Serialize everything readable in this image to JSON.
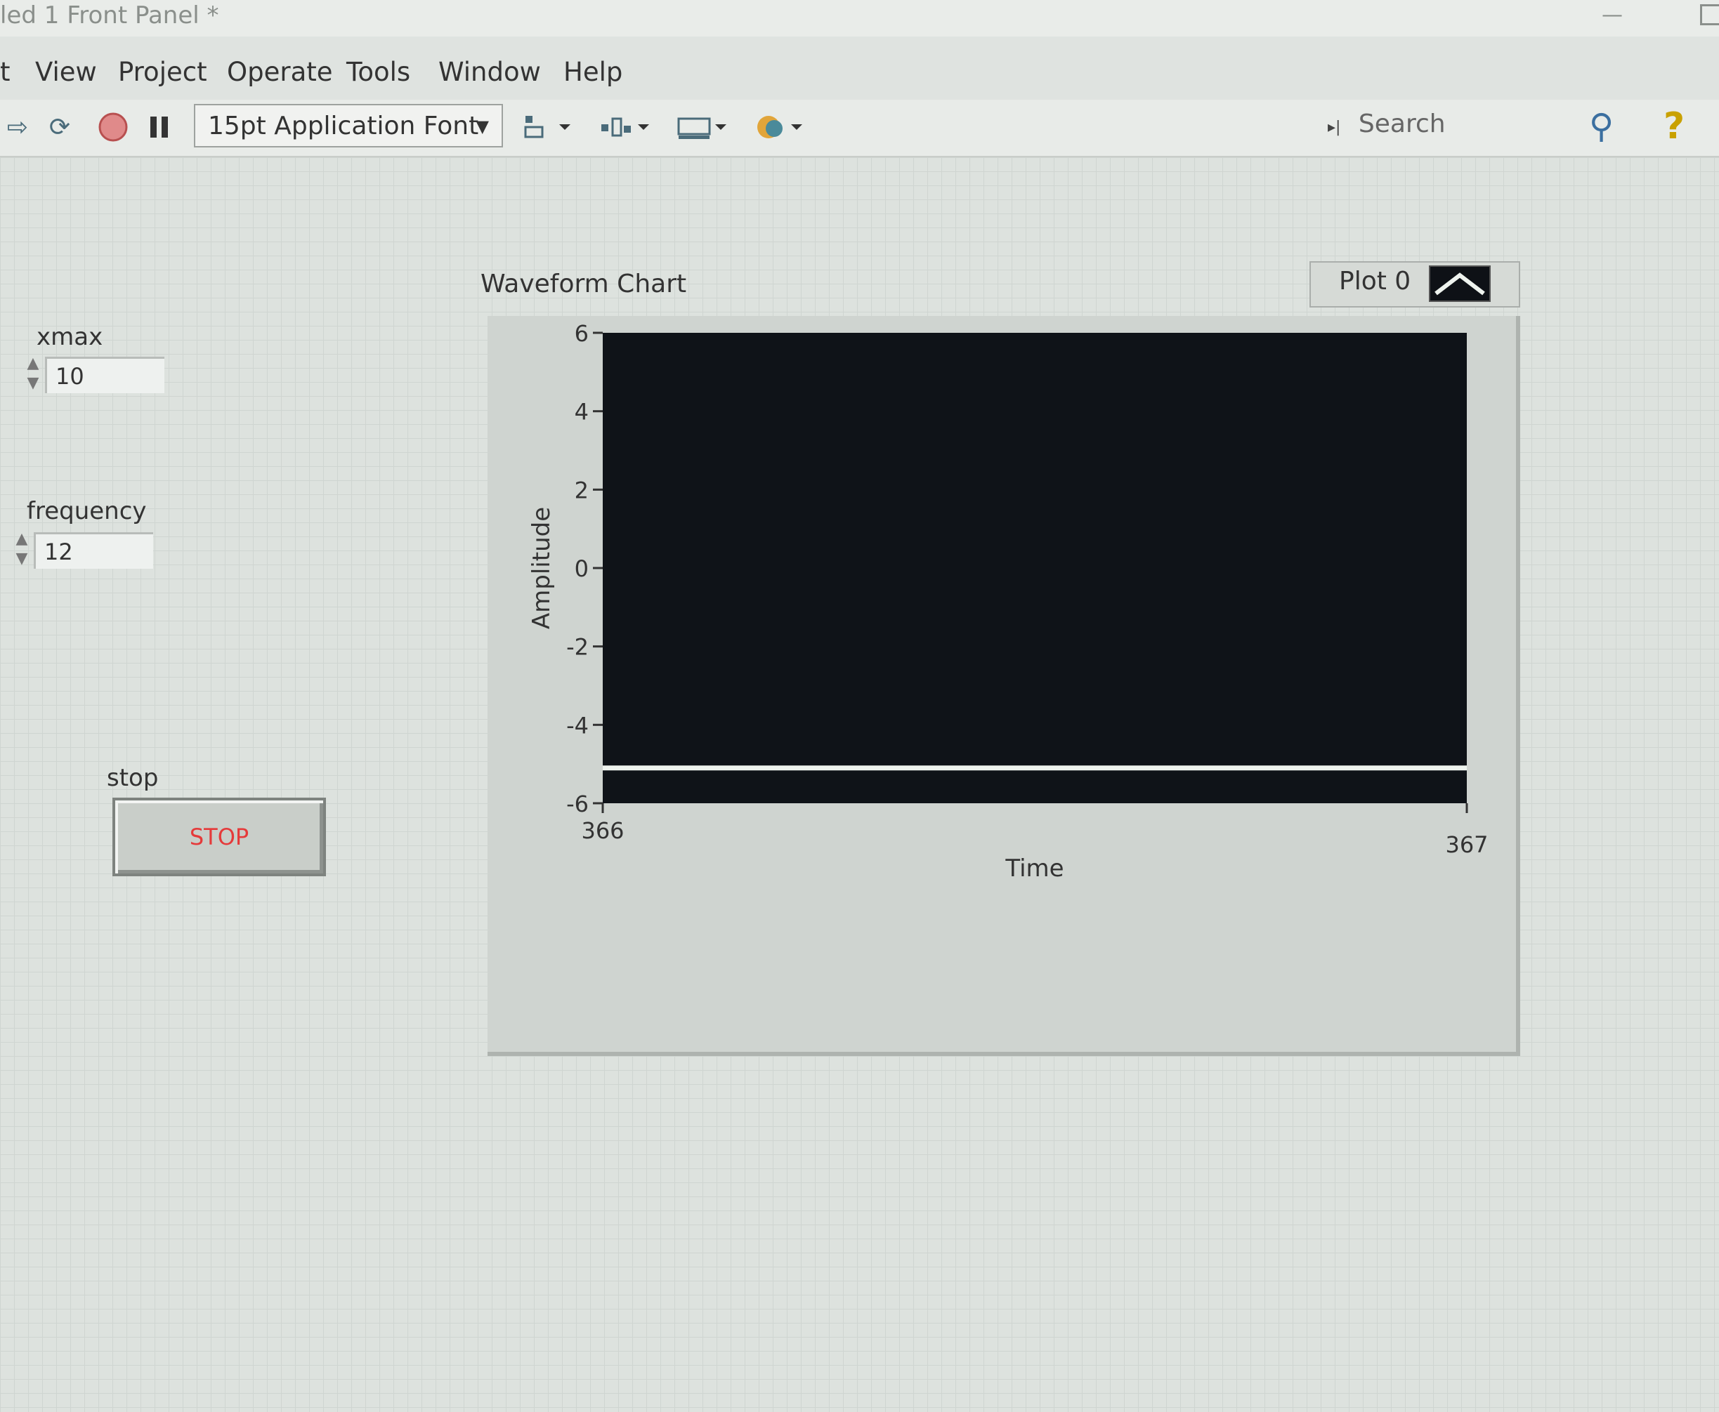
{
  "window": {
    "title": "led 1 Front Panel *"
  },
  "menu": [
    "t",
    "View",
    "Project",
    "Operate",
    "Tools",
    "Window",
    "Help"
  ],
  "toolbar": {
    "font_selector": "15pt Application Font",
    "search_placeholder": "Search"
  },
  "controls": {
    "xmax": {
      "label": "xmax",
      "value": "10"
    },
    "frequency": {
      "label": "frequency",
      "value": "12"
    },
    "stop": {
      "label": "stop",
      "button_text": "STOP"
    }
  },
  "colors": {
    "plot_background": "#0f1318",
    "trace": "#eef3ee",
    "stop_text": "#e53a3a"
  },
  "chart_data": {
    "type": "line",
    "title": "Waveform Chart",
    "xlabel": "Time",
    "ylabel": "Amplitude",
    "legend": "Plot 0",
    "legend_position": "top-right",
    "x_ticks": [
      "366",
      "367"
    ],
    "y_ticks": [
      "6",
      "4",
      "2",
      "0",
      "-2",
      "-4",
      "-6"
    ],
    "xlim": [
      366,
      367
    ],
    "ylim": [
      -6,
      6
    ],
    "grid": false,
    "series": [
      {
        "name": "Plot 0",
        "x": [
          366,
          367
        ],
        "y": [
          -5.1,
          -5.1
        ]
      }
    ]
  }
}
